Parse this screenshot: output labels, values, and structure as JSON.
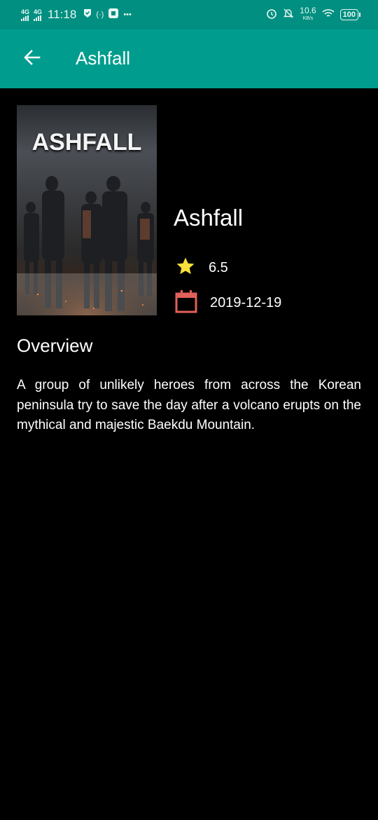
{
  "status_bar": {
    "network_1": "4G",
    "network_2": "4G",
    "time": "11:18",
    "data_speed": "10.6",
    "data_speed_unit": "KB/s",
    "battery": "100",
    "icons": [
      "signal-icon",
      "signal-icon",
      "check-shield-icon",
      "hotspot-icon",
      "app-icon",
      "more-icon",
      "alarm-icon",
      "mute-icon",
      "wifi-icon",
      "battery-icon"
    ]
  },
  "app_bar": {
    "title": "Ashfall",
    "back_icon": "arrow-left-icon",
    "background": "#009d8e"
  },
  "movie": {
    "poster_logo": "ASHFALL",
    "title": "Ashfall",
    "rating": "6.5",
    "release_date": "2019-12-19",
    "rating_icon": "star-icon",
    "date_icon": "calendar-icon",
    "star_color": "#f7e03b",
    "calendar_color": "#e2605a"
  },
  "overview": {
    "heading": "Overview",
    "text": "A group of unlikely heroes from across the Korean peninsula try to save the day after a volcano erupts on the mythical and majestic Baekdu Mountain."
  }
}
